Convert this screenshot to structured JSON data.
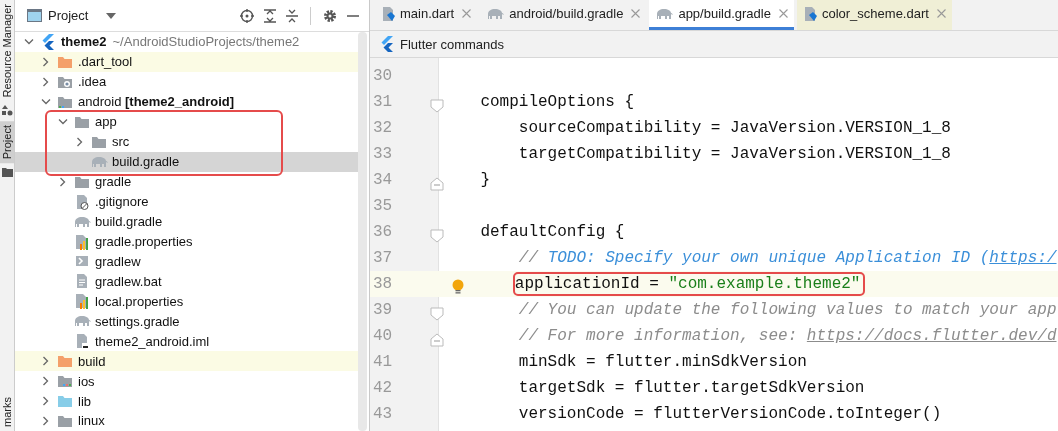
{
  "side_stripe": [
    {
      "label": "Resource Manager",
      "selected": false
    },
    {
      "label": "Project",
      "selected": true
    },
    {
      "label": "marks",
      "selected": false
    }
  ],
  "project_panel": {
    "title": "Project",
    "tree": [
      {
        "label": "theme2",
        "path": "~/AndroidStudioProjects/theme2",
        "kind": "module",
        "expanded": true,
        "selected": false,
        "highlighted": false,
        "children": [
          {
            "label": ".dart_tool",
            "kind": "folder-excluded",
            "expanded": false,
            "selected": false,
            "highlighted": true
          },
          {
            "label": ".idea",
            "kind": "folder-idea",
            "expanded": false,
            "selected": false,
            "highlighted": false
          },
          {
            "label": "android **[theme2_android]**",
            "kind": "folder-android",
            "expanded": true,
            "selected": false,
            "highlighted": false,
            "children": [
              {
                "label": "app",
                "kind": "folder",
                "expanded": true,
                "selected": false,
                "highlighted": false,
                "annotated": true,
                "children": [
                  {
                    "label": "src",
                    "kind": "folder",
                    "expanded": false,
                    "selected": false,
                    "highlighted": false
                  },
                  {
                    "label": "build.gradle",
                    "kind": "gradle",
                    "selected": true,
                    "highlighted": false
                  }
                ]
              },
              {
                "label": "gradle",
                "kind": "folder",
                "expanded": false,
                "selected": false,
                "highlighted": false
              },
              {
                "label": ".gitignore",
                "kind": "ignore",
                "selected": false,
                "highlighted": false
              },
              {
                "label": "build.gradle",
                "kind": "gradle",
                "selected": false,
                "highlighted": false
              },
              {
                "label": "gradle.properties",
                "kind": "properties",
                "selected": false,
                "highlighted": false
              },
              {
                "label": "gradlew",
                "kind": "script",
                "selected": false,
                "highlighted": false
              },
              {
                "label": "gradlew.bat",
                "kind": "text",
                "selected": false,
                "highlighted": false
              },
              {
                "label": "local.properties",
                "kind": "properties",
                "selected": false,
                "highlighted": false
              },
              {
                "label": "settings.gradle",
                "kind": "gradle",
                "selected": false,
                "highlighted": false
              },
              {
                "label": "theme2_android.iml",
                "kind": "iml",
                "selected": false,
                "highlighted": false
              }
            ]
          },
          {
            "label": "build",
            "kind": "folder-excluded",
            "expanded": false,
            "selected": false,
            "highlighted": true
          },
          {
            "label": "ios",
            "kind": "folder-ios",
            "expanded": false,
            "selected": false,
            "highlighted": false
          },
          {
            "label": "lib",
            "kind": "folder-source",
            "expanded": false,
            "selected": false,
            "highlighted": false
          },
          {
            "label": "linux",
            "kind": "folder",
            "expanded": false,
            "selected": false,
            "highlighted": false
          }
        ]
      }
    ]
  },
  "editor": {
    "tabs": [
      {
        "label": "main.dart",
        "kind": "dart",
        "selected": false,
        "highlighted": false
      },
      {
        "label": "android/build.gradle",
        "kind": "gradle",
        "selected": false,
        "highlighted": false
      },
      {
        "label": "app/build.gradle",
        "kind": "gradle",
        "selected": true,
        "highlighted": false
      },
      {
        "label": "color_scheme.dart",
        "kind": "dart",
        "selected": false,
        "highlighted": true
      }
    ],
    "toolbar": {
      "label": "Flutter commands"
    },
    "lines": [
      {
        "number": "30",
        "current": false,
        "bulb": false,
        "annotated": false,
        "fold_start": false,
        "fold_end": false
      },
      {
        "number": "31",
        "current": false,
        "bulb": false,
        "annotated": false,
        "fold_start": true,
        "fold_end": false,
        "segments": [
          {
            "kind": "plain",
            "text": "    compileOptions {"
          }
        ]
      },
      {
        "number": "32",
        "current": false,
        "bulb": false,
        "annotated": false,
        "fold_start": false,
        "fold_end": false,
        "segments": [
          {
            "kind": "plain",
            "text": "        sourceCompatibility = JavaVersion.VERSION_1_8"
          }
        ]
      },
      {
        "number": "33",
        "current": false,
        "bulb": false,
        "annotated": false,
        "fold_start": false,
        "fold_end": false,
        "segments": [
          {
            "kind": "plain",
            "text": "        targetCompatibility = JavaVersion.VERSION_1_8"
          }
        ]
      },
      {
        "number": "34",
        "current": false,
        "bulb": false,
        "annotated": false,
        "fold_start": false,
        "fold_end": true,
        "segments": [
          {
            "kind": "plain",
            "text": "    }"
          }
        ]
      },
      {
        "number": "35",
        "current": false,
        "bulb": false,
        "annotated": false,
        "fold_start": false,
        "fold_end": false
      },
      {
        "number": "36",
        "current": false,
        "bulb": false,
        "annotated": false,
        "fold_start": true,
        "fold_end": false,
        "segments": [
          {
            "kind": "plain",
            "text": "    defaultConfig {"
          }
        ]
      },
      {
        "number": "37",
        "current": false,
        "bulb": false,
        "annotated": false,
        "fold_start": false,
        "fold_end": false,
        "segments": [
          {
            "kind": "comment",
            "text": "        // "
          },
          {
            "kind": "todo",
            "text": "TODO: Specify your own unique Application ID ("
          },
          {
            "kind": "todo-link",
            "text": "https:/"
          }
        ]
      },
      {
        "number": "38",
        "current": true,
        "bulb": true,
        "annotated": true,
        "fold_start": false,
        "fold_end": false,
        "segments": [
          {
            "kind": "plain",
            "text": "        applicationId = "
          },
          {
            "kind": "string",
            "text": "\"com.example.theme2\""
          }
        ]
      },
      {
        "number": "39",
        "current": false,
        "bulb": false,
        "annotated": false,
        "fold_start": true,
        "fold_end": false,
        "segments": [
          {
            "kind": "comment",
            "text": "        // You can update the following values to match your app"
          }
        ]
      },
      {
        "number": "40",
        "current": false,
        "bulb": false,
        "annotated": false,
        "fold_start": false,
        "fold_end": true,
        "segments": [
          {
            "kind": "comment",
            "text": "        // For more information, see: "
          },
          {
            "kind": "comment-link",
            "text": "https://docs.flutter.dev/d"
          }
        ]
      },
      {
        "number": "41",
        "current": false,
        "bulb": false,
        "annotated": false,
        "fold_start": false,
        "fold_end": false,
        "segments": [
          {
            "kind": "plain",
            "text": "        minSdk = flutter.minSdkVersion"
          }
        ]
      },
      {
        "number": "42",
        "current": false,
        "bulb": false,
        "annotated": false,
        "fold_start": false,
        "fold_end": false,
        "segments": [
          {
            "kind": "plain",
            "text": "        targetSdk = flutter.targetSdkVersion"
          }
        ]
      },
      {
        "number": "43",
        "current": false,
        "bulb": false,
        "annotated": false,
        "fold_start": false,
        "fold_end": false,
        "segments": [
          {
            "kind": "plain",
            "text": "        versionCode = flutterVersionCode.toInteger()"
          }
        ]
      }
    ]
  }
}
